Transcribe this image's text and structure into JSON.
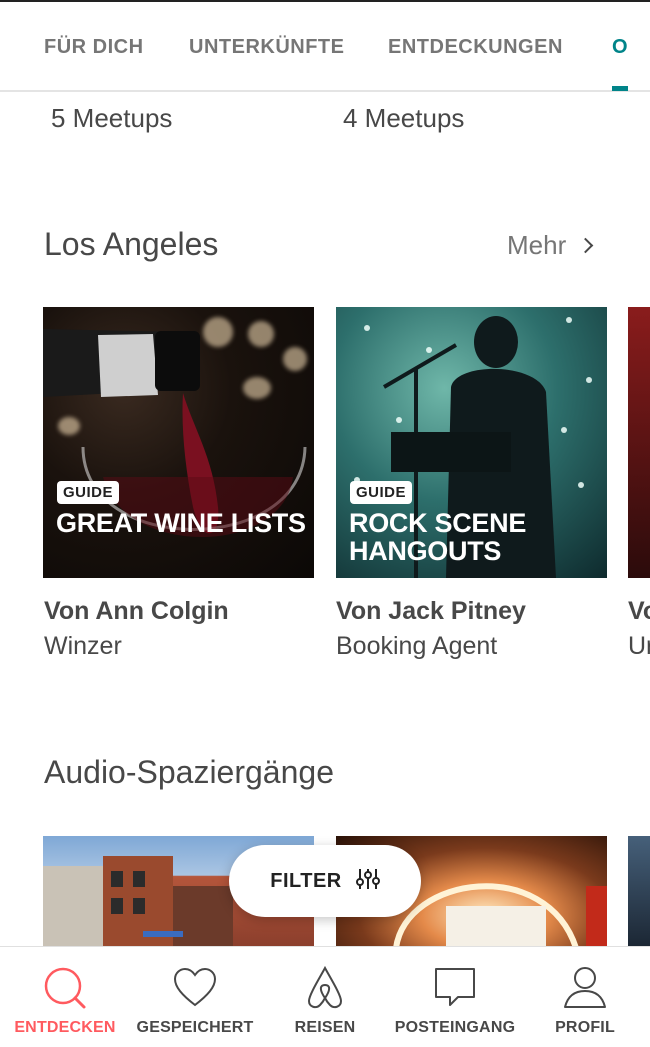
{
  "top_tabs": [
    {
      "label": "FÜR DICH"
    },
    {
      "label": "UNTERKÜNFTE"
    },
    {
      "label": "ENTDECKUNGEN"
    },
    {
      "label": "O"
    }
  ],
  "meetups": [
    "5 Meetups",
    "4 Meetups"
  ],
  "section_la": {
    "title": "Los Angeles",
    "more": "Mehr",
    "cards": [
      {
        "badge": "GUIDE",
        "title": "GREAT WINE LISTS",
        "author": "Von Ann Colgin",
        "role": "Winzer"
      },
      {
        "badge": "GUIDE",
        "title": "ROCK SCENE HANGOUTS",
        "author": "Von Jack Pitney",
        "role": "Booking Agent"
      },
      {
        "author": "Vo",
        "role": "Ur"
      }
    ]
  },
  "section_audio": {
    "title": "Audio-Spaziergänge"
  },
  "filter": {
    "label": "FILTER",
    "icon": "sliders-icon"
  },
  "bottom_nav": [
    {
      "label": "ENTDECKEN",
      "icon": "search-icon",
      "active": true
    },
    {
      "label": "GESPEICHERT",
      "icon": "heart-icon"
    },
    {
      "label": "REISEN",
      "icon": "airbnb-logo-icon"
    },
    {
      "label": "POSTEINGANG",
      "icon": "message-icon"
    },
    {
      "label": "PROFIL",
      "icon": "person-icon"
    }
  ],
  "colors": {
    "accent_teal": "#008489",
    "accent_red": "#ff5a5f",
    "text": "#484848"
  }
}
